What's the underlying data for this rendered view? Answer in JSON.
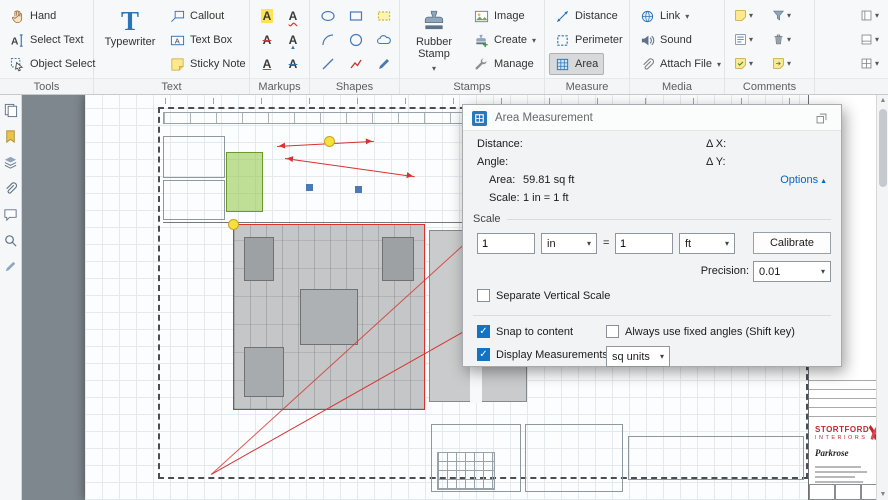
{
  "ribbon": {
    "groups": {
      "tools": {
        "label": "Tools",
        "items": [
          {
            "label": "Hand"
          },
          {
            "label": "Select Text"
          },
          {
            "label": "Object Select"
          }
        ]
      },
      "text": {
        "label": "Text",
        "big_label": "Typewriter",
        "items": [
          {
            "label": "Callout"
          },
          {
            "label": "Text Box"
          },
          {
            "label": "Sticky Note"
          }
        ]
      },
      "markups": {
        "label": "Markups"
      },
      "shapes": {
        "label": "Shapes"
      },
      "stamps": {
        "label": "Stamps",
        "big_label": "Rubber Stamp",
        "items": [
          {
            "label": "Image"
          },
          {
            "label": "Create"
          },
          {
            "label": "Manage"
          }
        ]
      },
      "measure": {
        "label": "Measure",
        "items": [
          {
            "label": "Distance"
          },
          {
            "label": "Perimeter"
          },
          {
            "label": "Area"
          }
        ],
        "selected_item": "Area"
      },
      "media": {
        "label": "Media",
        "items": [
          {
            "label": "Link"
          },
          {
            "label": "Sound"
          },
          {
            "label": "Attach File"
          }
        ]
      },
      "comments": {
        "label": "Comments"
      }
    }
  },
  "dialog": {
    "title": "Area Measurement",
    "distance_label": "Distance:",
    "angle_label": "Angle:",
    "dx_label": "Δ X:",
    "dy_label": "Δ Y:",
    "area_label": "Area:",
    "area_value": "59.81 sq ft",
    "scale_label": "Scale:",
    "scale_value": "1 in = 1 ft",
    "options_label": "Options",
    "scale_section": {
      "heading": "Scale",
      "from_value": "1",
      "from_unit": "in",
      "equals": "=",
      "to_value": "1",
      "to_unit": "ft",
      "calibrate_label": "Calibrate",
      "precision_label": "Precision:",
      "precision_value": "0.01",
      "separate_vertical_label": "Separate Vertical Scale"
    },
    "toggles": {
      "snap_label": "Snap to content",
      "snap_checked": true,
      "fixed_angles_label": "Always use fixed angles (Shift key)",
      "fixed_angles_checked": false,
      "display_label": "Display Measurements",
      "display_checked": true,
      "units_value": "sq units"
    }
  },
  "plan": {
    "title_block": {
      "company_line1": "STORTFORD",
      "company_line2": "INTERIORS",
      "project": "Parkrose"
    }
  },
  "colors": {
    "accent_blue": "#2e74b5",
    "selection_red": "#d8322e",
    "highlight_yellow": "#f6e13b",
    "highlight_green": "#8cc63f",
    "canvas_gray": "#7e868e"
  },
  "icons": {
    "hand-icon": "hand",
    "select-text-icon": "A with text cursor",
    "object-select-icon": "pointer arrow",
    "typewriter-icon": "serif T",
    "callout-icon": "callout box with leader",
    "text-box-icon": "boxed A",
    "sticky-note-icon": "yellow folded note",
    "rubber-stamp-icon": "stamp",
    "image-icon": "picture",
    "create-icon": "stamp with plus",
    "manage-icon": "wrench",
    "distance-icon": "arrowed line",
    "perimeter-icon": "dashed square",
    "area-icon": "blue grid square",
    "link-icon": "globe",
    "sound-icon": "speaker",
    "attach-file-icon": "paperclip",
    "filter-icon": "funnel",
    "trash-icon": "trash can",
    "note-icon": "sticky note",
    "chevron-down-icon": "▾",
    "check-icon": "✓"
  }
}
